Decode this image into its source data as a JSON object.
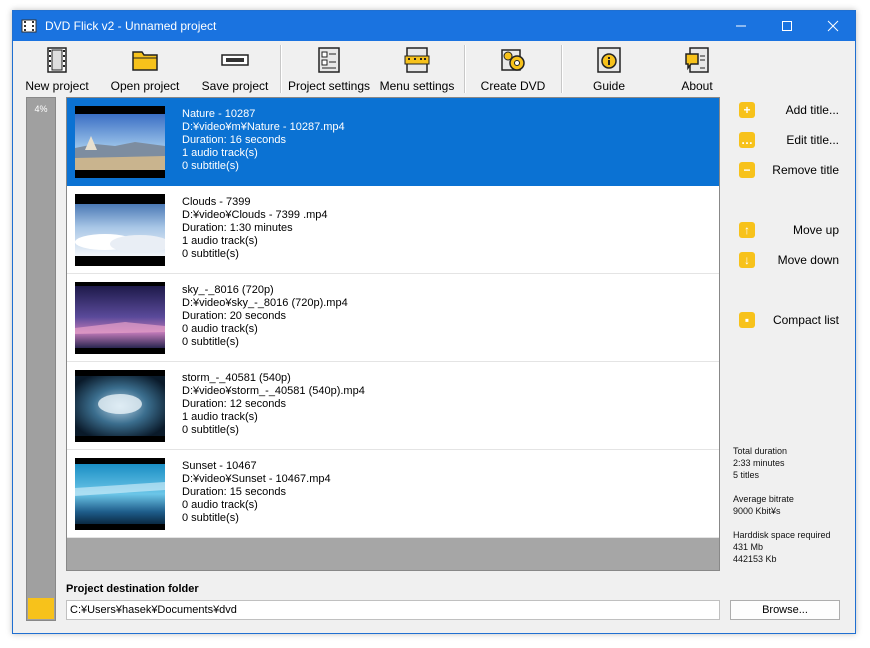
{
  "window": {
    "title": "DVD Flick v2 - Unnamed project",
    "controls": {
      "minimize": "—",
      "maximize": "☐",
      "close": "✕"
    }
  },
  "toolbar": {
    "new_project": "New project",
    "open_project": "Open project",
    "save_project": "Save project",
    "project_settings": "Project settings",
    "menu_settings": "Menu settings",
    "create_dvd": "Create DVD",
    "guide": "Guide",
    "about": "About"
  },
  "progress": {
    "text": "4%",
    "fraction": 0.04,
    "color": "#f7c21b"
  },
  "titles": [
    {
      "name": "Nature - 10287",
      "path": "D:¥video¥m¥Nature - 10287.mp4",
      "duration": "Duration: 16 seconds",
      "audio": "1 audio track(s)",
      "subtitles": "0 subtitle(s)",
      "selected": true
    },
    {
      "name": "Clouds - 7399",
      "path": "D:¥video¥Clouds - 7399 .mp4",
      "duration": "Duration: 1:30 minutes",
      "audio": "1 audio track(s)",
      "subtitles": "0 subtitle(s)",
      "selected": false
    },
    {
      "name": "sky_-_8016 (720p)",
      "path": "D:¥video¥sky_-_8016 (720p).mp4",
      "duration": "Duration: 20 seconds",
      "audio": "0 audio track(s)",
      "subtitles": "0 subtitle(s)",
      "selected": false
    },
    {
      "name": "storm_-_40581 (540p)",
      "path": "D:¥video¥storm_-_40581 (540p).mp4",
      "duration": "Duration: 12 seconds",
      "audio": "1 audio track(s)",
      "subtitles": "0 subtitle(s)",
      "selected": false
    },
    {
      "name": "Sunset - 10467",
      "path": "D:¥video¥Sunset - 10467.mp4",
      "duration": "Duration: 15 seconds",
      "audio": "0 audio track(s)",
      "subtitles": "0 subtitle(s)",
      "selected": false
    }
  ],
  "side_actions": {
    "add_title": "Add title...",
    "edit_title": "Edit title...",
    "remove_title": "Remove title",
    "move_up": "Move up",
    "move_down": "Move down",
    "compact_list": "Compact list"
  },
  "stats": {
    "total_duration_label": "Total duration",
    "total_duration_value": "2:33 minutes",
    "titles_count": "5 titles",
    "average_bitrate_label": "Average bitrate",
    "average_bitrate_value": "9000 Kbit¥s",
    "harddisk_label": "Harddisk space required",
    "harddisk_mb": "431 Mb",
    "harddisk_kb": "442153 Kb"
  },
  "destination": {
    "label": "Project destination folder",
    "value": "C:¥Users¥hasek¥Documents¥dvd",
    "browse": "Browse..."
  },
  "colors": {
    "titlebar": "#1a73e0",
    "selection": "#0b72d3",
    "accent_yellow": "#f7c21b"
  }
}
